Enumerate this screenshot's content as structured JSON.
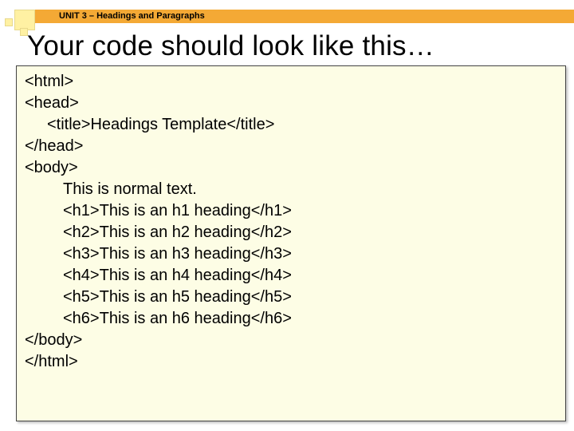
{
  "header": {
    "unit_label": "UNIT 3 – Headings and Paragraphs"
  },
  "title": "Your code should look like this…",
  "code": {
    "l1": "<html>",
    "l2": "<head>",
    "l3": "<title>Headings Template</title>",
    "l4": "</head>",
    "l5": "<body>",
    "l6": "This is normal text.",
    "l7": "<h1>This is an h1 heading</h1>",
    "l8": "<h2>This is an h2 heading</h2>",
    "l9": "<h3>This is an h3 heading</h3>",
    "l10": "<h4>This is an h4 heading</h4>",
    "l11": "<h5>This is an h5 heading</h5>",
    "l12": "<h6>This is an h6 heading</h6>",
    "l13": "</body>",
    "l14": "</html>"
  }
}
